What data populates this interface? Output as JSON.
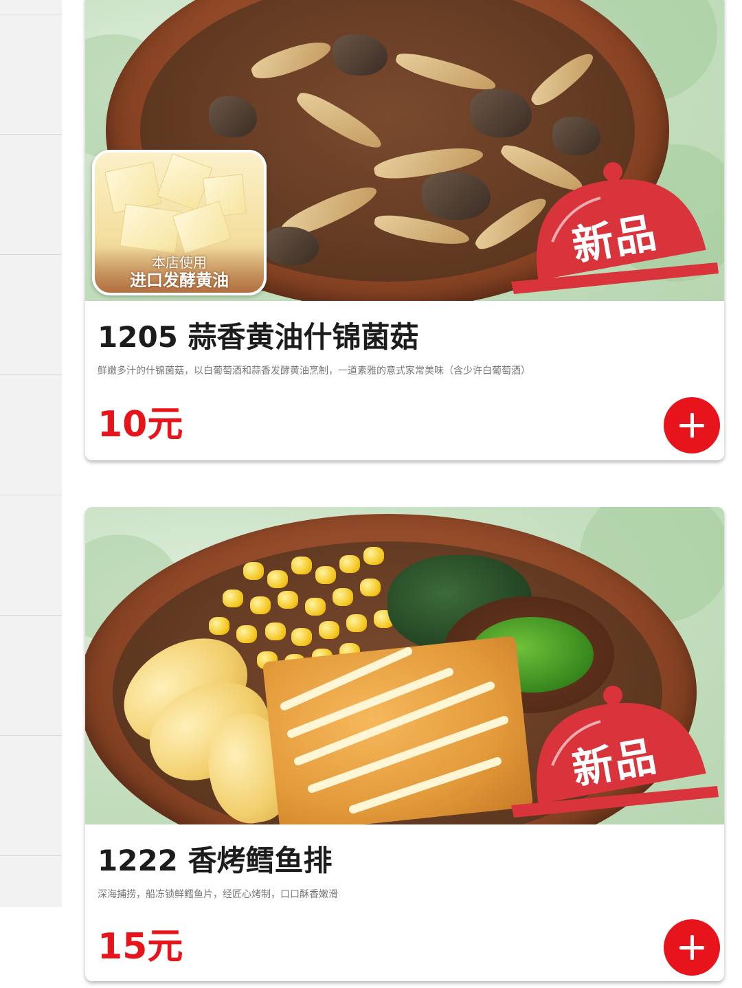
{
  "menu": {
    "items": [
      {
        "id": "1205",
        "title": "1205 蒜香黄油什锦菌菇",
        "description": "鲜嫩多汁的什锦菌菇，以白葡萄酒和蒜香发酵黄油烹制，一道素雅的意式家常美味（含少许白葡萄酒）",
        "price": "10元",
        "new_badge": "新品",
        "feature_badge": {
          "line1": "本店使用",
          "line2": "进口发酵黄油"
        },
        "add_icon": "plus-icon"
      },
      {
        "id": "1222",
        "title": "1222 香烤鳕鱼排",
        "description": "深海捕捞，船冻锁鲜鳕鱼片，经匠心烤制，口口酥香嫩滑",
        "price": "15元",
        "new_badge": "新品",
        "add_icon": "plus-icon"
      }
    ]
  },
  "colors": {
    "accent": "#e8141b",
    "new_badge": "#d9333b",
    "sidebar_bg": "#f2f2f2"
  }
}
